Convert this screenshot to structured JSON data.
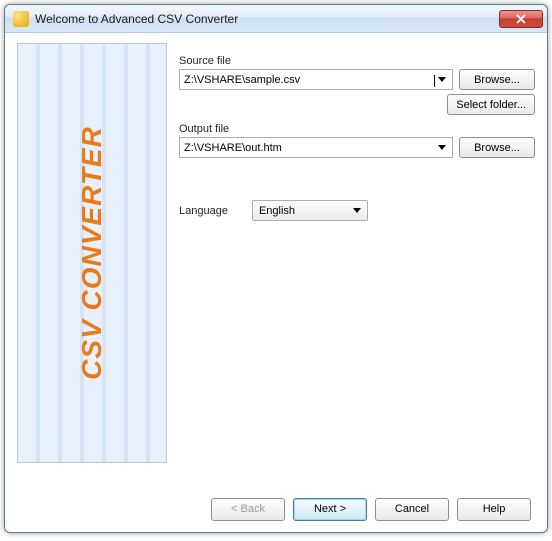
{
  "window": {
    "title": "Welcome to Advanced CSV Converter"
  },
  "sidebar": {
    "brand": "CSV CONVERTER"
  },
  "source": {
    "label": "Source file",
    "value": "Z:\\VSHARE\\sample.csv",
    "browse": "Browse...",
    "select_folder": "Select folder..."
  },
  "output": {
    "label": "Output file",
    "value": "Z:\\VSHARE\\out.htm",
    "browse": "Browse..."
  },
  "language": {
    "label": "Language",
    "value": "English"
  },
  "footer": {
    "back": "< Back",
    "next": "Next >",
    "cancel": "Cancel",
    "help": "Help"
  }
}
